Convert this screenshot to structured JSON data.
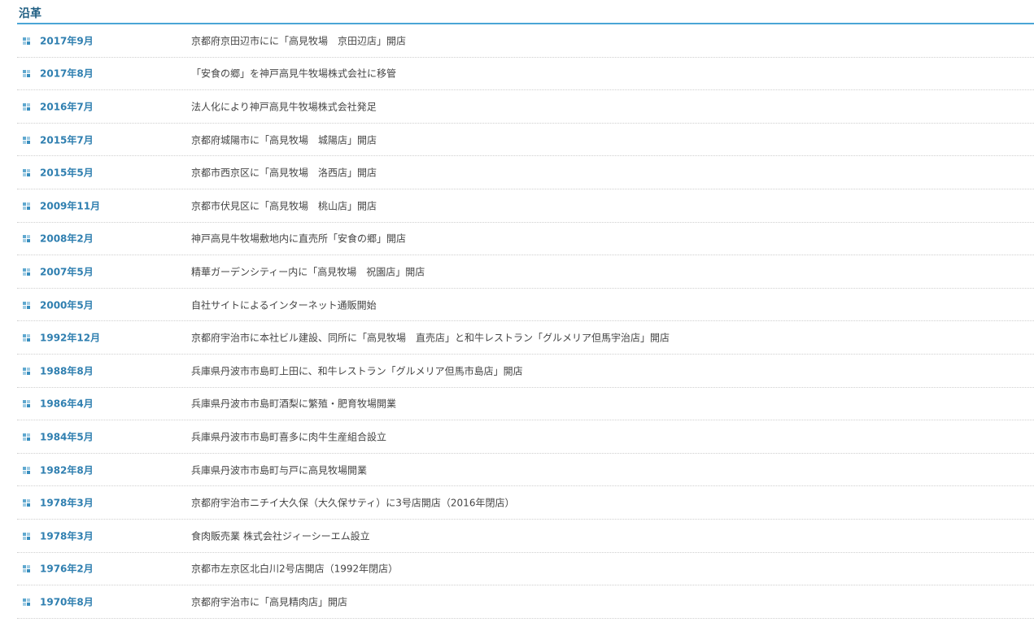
{
  "section": {
    "title": "沿革"
  },
  "history": [
    {
      "date": "2017年9月",
      "text": "京都府京田辺市にに「高見牧場　京田辺店」開店"
    },
    {
      "date": "2017年8月",
      "text": "「安食の郷」を神戸高見牛牧場株式会社に移管"
    },
    {
      "date": "2016年7月",
      "text": "法人化により神戸高見牛牧場株式会社発足"
    },
    {
      "date": "2015年7月",
      "text": "京都府城陽市に「高見牧場　城陽店」開店"
    },
    {
      "date": "2015年5月",
      "text": "京都市西京区に「高見牧場　洛西店」開店"
    },
    {
      "date": "2009年11月",
      "text": "京都市伏見区に「高見牧場　桃山店」開店"
    },
    {
      "date": "2008年2月",
      "text": "神戸高見牛牧場敷地内に直売所「安食の郷」開店"
    },
    {
      "date": "2007年5月",
      "text": "精華ガーデンシティー内に「高見牧場　祝園店」開店"
    },
    {
      "date": "2000年5月",
      "text": "自社サイトによるインターネット通販開始"
    },
    {
      "date": "1992年12月",
      "text": "京都府宇治市に本社ビル建設、同所に「高見牧場　直売店」と和牛レストラン「グルメリア但馬宇治店」開店"
    },
    {
      "date": "1988年8月",
      "text": "兵庫県丹波市市島町上田に、和牛レストラン「グルメリア但馬市島店」開店"
    },
    {
      "date": "1986年4月",
      "text": "兵庫県丹波市市島町酒梨に繁殖・肥育牧場開業"
    },
    {
      "date": "1984年5月",
      "text": "兵庫県丹波市市島町喜多に肉牛生産組合設立"
    },
    {
      "date": "1982年8月",
      "text": "兵庫県丹波市市島町与戸に高見牧場開業"
    },
    {
      "date": "1978年3月",
      "text": "京都府宇治市ニチイ大久保（大久保サティ）に3号店開店（2016年閉店）"
    },
    {
      "date": "1978年3月",
      "text": "食肉販売業 株式会社ジィーシーエム設立"
    },
    {
      "date": "1976年2月",
      "text": "京都市左京区北白川2号店開店（1992年閉店）"
    },
    {
      "date": "1970年8月",
      "text": "京都府宇治市に「高見精肉店」開店"
    }
  ]
}
